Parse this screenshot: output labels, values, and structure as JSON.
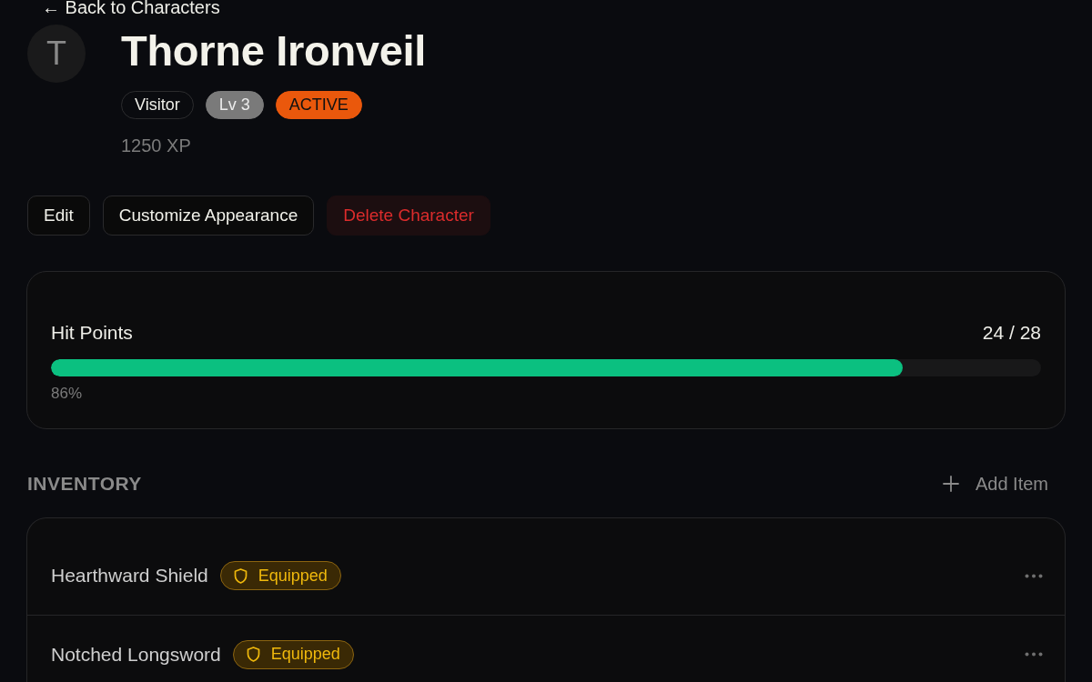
{
  "back_link": {
    "label": "← Back to Characters"
  },
  "character": {
    "avatar_initial": "T",
    "name": "Thorne Ironveil",
    "badges": [
      {
        "label": "Visitor",
        "kind": "outline"
      },
      {
        "label": "Lv 3",
        "kind": "level"
      },
      {
        "label": "ACTIVE",
        "kind": "status"
      }
    ],
    "xp": "1250 XP"
  },
  "actions": [
    {
      "label": "Edit",
      "kind": "default"
    },
    {
      "label": "Customize Appearance",
      "kind": "default"
    },
    {
      "label": "Delete Character",
      "kind": "danger"
    }
  ],
  "hit_points": {
    "label": "Hit Points",
    "reading": "24 / 28",
    "level": 0.86,
    "percent": "86%"
  },
  "inventory": {
    "title": "INVENTORY",
    "add_button": "Add Item",
    "items": [
      {
        "name": "Hearthward Shield",
        "equipped": true,
        "badge": "Equipped"
      },
      {
        "name": "Notched Longsword",
        "equipped": true,
        "badge": "Equipped"
      }
    ]
  }
}
